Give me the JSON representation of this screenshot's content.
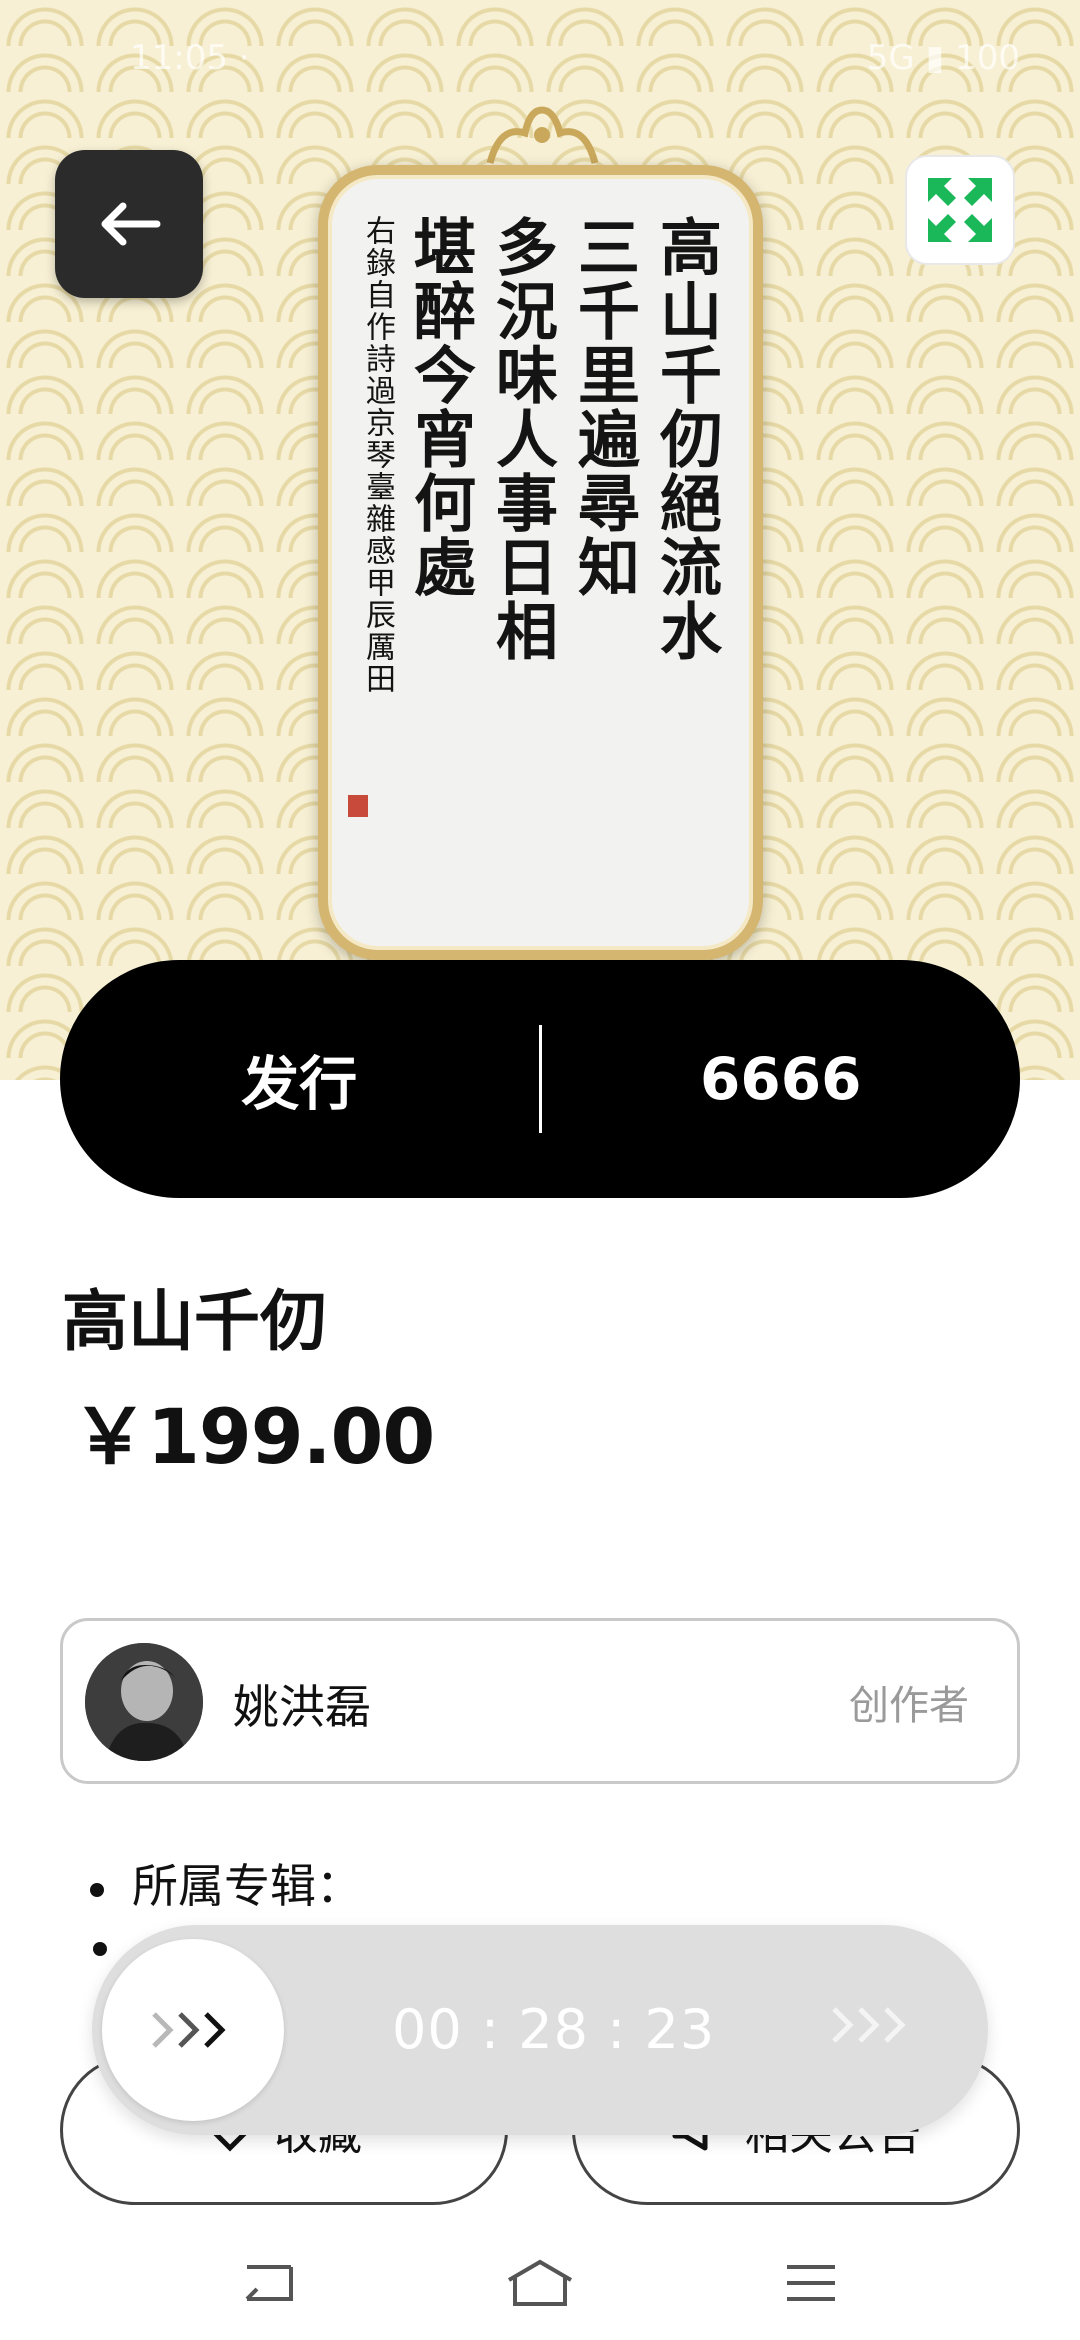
{
  "status_bar": {
    "left": "11:05 ·",
    "right": "5G ▮ 100"
  },
  "artwork": {
    "columns": [
      "高山千仞絕流水",
      "三千里遍尋知",
      "多況味人事日相",
      "堪醉今宵何處",
      "右錄自作詩過京琴臺雜感甲辰厲田"
    ]
  },
  "issue": {
    "label": "发行",
    "count": "6666"
  },
  "product": {
    "title": "高山千仞",
    "price": "￥199.00"
  },
  "creator": {
    "name": "姚洪磊",
    "role": "创作者"
  },
  "details": {
    "album_label": "所属专辑："
  },
  "actions": {
    "collect_label": "收藏",
    "related_label": "相关公告"
  },
  "countdown": {
    "time": "00 : 28 : 23"
  },
  "colors": {
    "accent_black": "#000000",
    "expand_green": "#1bb85a",
    "frame_gold": "#d4b670"
  }
}
